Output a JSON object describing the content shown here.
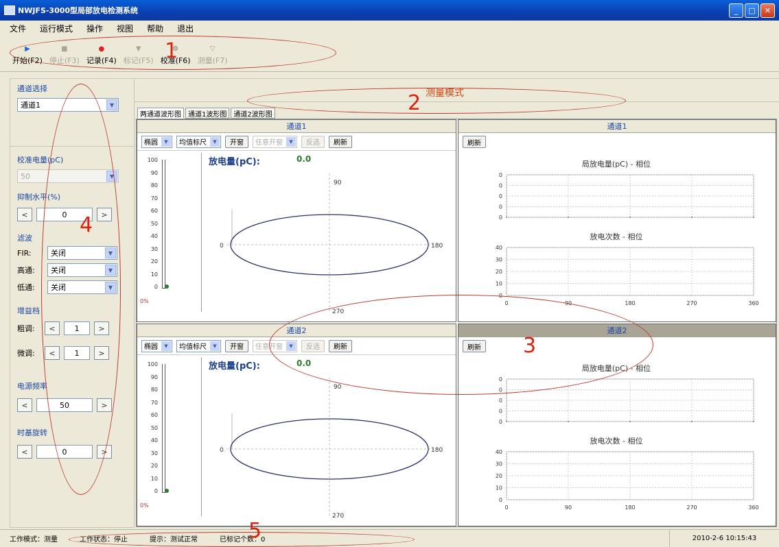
{
  "window": {
    "title": "NWJFS-3000型局部放电检测系统"
  },
  "menu": [
    "文件",
    "运行模式",
    "操作",
    "视图",
    "帮助",
    "退出"
  ],
  "toolbar": [
    {
      "label": "开始(F2)",
      "icon": "play-icon",
      "enabled": true
    },
    {
      "label": "停止(F3)",
      "icon": "stop-icon",
      "enabled": false
    },
    {
      "label": "记录(F4)",
      "icon": "record-icon",
      "enabled": true
    },
    {
      "label": "标记(F5)",
      "icon": "mark-icon",
      "enabled": false
    },
    {
      "label": "校准(F6)",
      "icon": "calibrate-icon",
      "enabled": true
    },
    {
      "label": "测量(F7)",
      "icon": "measure-icon",
      "enabled": false
    }
  ],
  "callouts": [
    "1",
    "2",
    "3",
    "4",
    "5"
  ],
  "left": {
    "channel_select_label": "通道选择",
    "channel_value": "通道1",
    "calib_label": "校准电量(pC)",
    "calib_value": "50",
    "suppress_label": "抑制水平(%)",
    "suppress_value": "0",
    "filter_label": "滤波",
    "filters": [
      {
        "name": "FIR:",
        "value": "关闭"
      },
      {
        "name": "高通:",
        "value": "关闭"
      },
      {
        "name": "低通:",
        "value": "关闭"
      }
    ],
    "gain_label": "增益档",
    "coarse_label": "粗调:",
    "coarse_value": "1",
    "fine_label": "微调:",
    "fine_value": "1",
    "freq_label": "电源频率",
    "freq_value": "50",
    "phase_label": "时基旋转",
    "phase_value": "0"
  },
  "mode": {
    "text": "测量模式"
  },
  "tabs": [
    "两通道波形图",
    "通道1波形图",
    "通道2波形图"
  ],
  "panes": [
    {
      "title": "通道1",
      "ch_title": "通道1"
    },
    {
      "title": "通道2",
      "ch_title": "通道2"
    }
  ],
  "pane_tools": {
    "shape": "椭圆",
    "scale": "均值标尺",
    "open": "开窗",
    "any_open": "任意开窗",
    "invert": "反选",
    "refresh": "刷新"
  },
  "meter": {
    "ticks": [
      "100",
      "90",
      "80",
      "70",
      "60",
      "50",
      "40",
      "30",
      "20",
      "10",
      "0"
    ],
    "pct": "0%"
  },
  "discharge": {
    "label": "放电量(pC):",
    "value": "0.0"
  },
  "ellipse_labels": {
    "top": "90",
    "left": "0",
    "right": "180",
    "bottom": "270"
  },
  "right_chart": {
    "amp_title": "局放电量(pC) - 相位",
    "cnt_title": "放电次数 - 相位",
    "amp_ticks": [
      "0",
      "0",
      "0",
      "0",
      "0"
    ],
    "cnt_ticks": [
      "40",
      "30",
      "20",
      "10",
      "0"
    ],
    "x_ticks": [
      "0",
      "90",
      "180",
      "270",
      "360"
    ]
  },
  "chart_data": [
    {
      "type": "line",
      "title": "局放电量(pC) - 相位",
      "x": [
        0,
        90,
        180,
        270,
        360
      ],
      "series": [
        {
          "values": [
            0,
            0,
            0,
            0,
            0
          ]
        }
      ],
      "xlim": [
        0,
        360
      ]
    },
    {
      "type": "bar",
      "title": "放电次数 - 相位",
      "x": [
        0,
        90,
        180,
        270,
        360
      ],
      "series": [
        {
          "values": [
            0,
            0,
            0,
            0,
            0
          ]
        }
      ],
      "xlim": [
        0,
        360
      ],
      "ylim": [
        0,
        40
      ]
    }
  ],
  "status": [
    "工作模式：测量",
    "工作状态：停止",
    "提示：测试正常",
    "已标记个数：0"
  ],
  "datetime": "2010-2-6  10:15:43"
}
